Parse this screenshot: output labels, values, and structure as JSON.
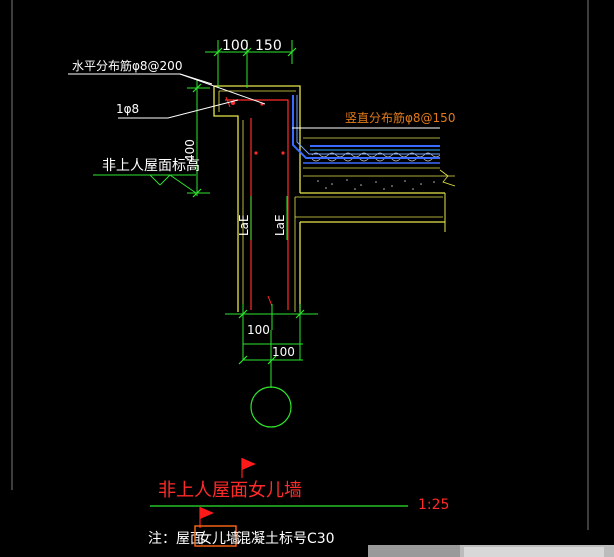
{
  "drawing": {
    "dims": {
      "top_left": "100",
      "top_right": "150",
      "bottom_first": "100",
      "bottom_second": "100",
      "parapet_height": "400"
    },
    "labels": {
      "horizontal_rebar": "水平分布筋φ8@200",
      "single_bar": "1φ8",
      "vertical_rebar": "竖直分布筋φ8@150",
      "roof_elevation": "非上人屋面标高",
      "anchor_left": "LaE",
      "anchor_right": "LaE"
    },
    "title": {
      "main": "非上人屋面女儿墙",
      "scale": "1:25"
    },
    "note": {
      "prefix": "注：屋面",
      "highlight": "女儿墙",
      "suffix": "混凝土标号C30"
    }
  },
  "colors": {
    "background": "#000000",
    "wall_outline": "#e6e64a",
    "dimension": "#2ee62e",
    "rebar_red": "#ff2a2a",
    "waterproof_blue": "#3a6bff",
    "leader_white": "#ffffff",
    "orange_text": "#e07a1a",
    "flag_red": "#ff1a1a"
  }
}
